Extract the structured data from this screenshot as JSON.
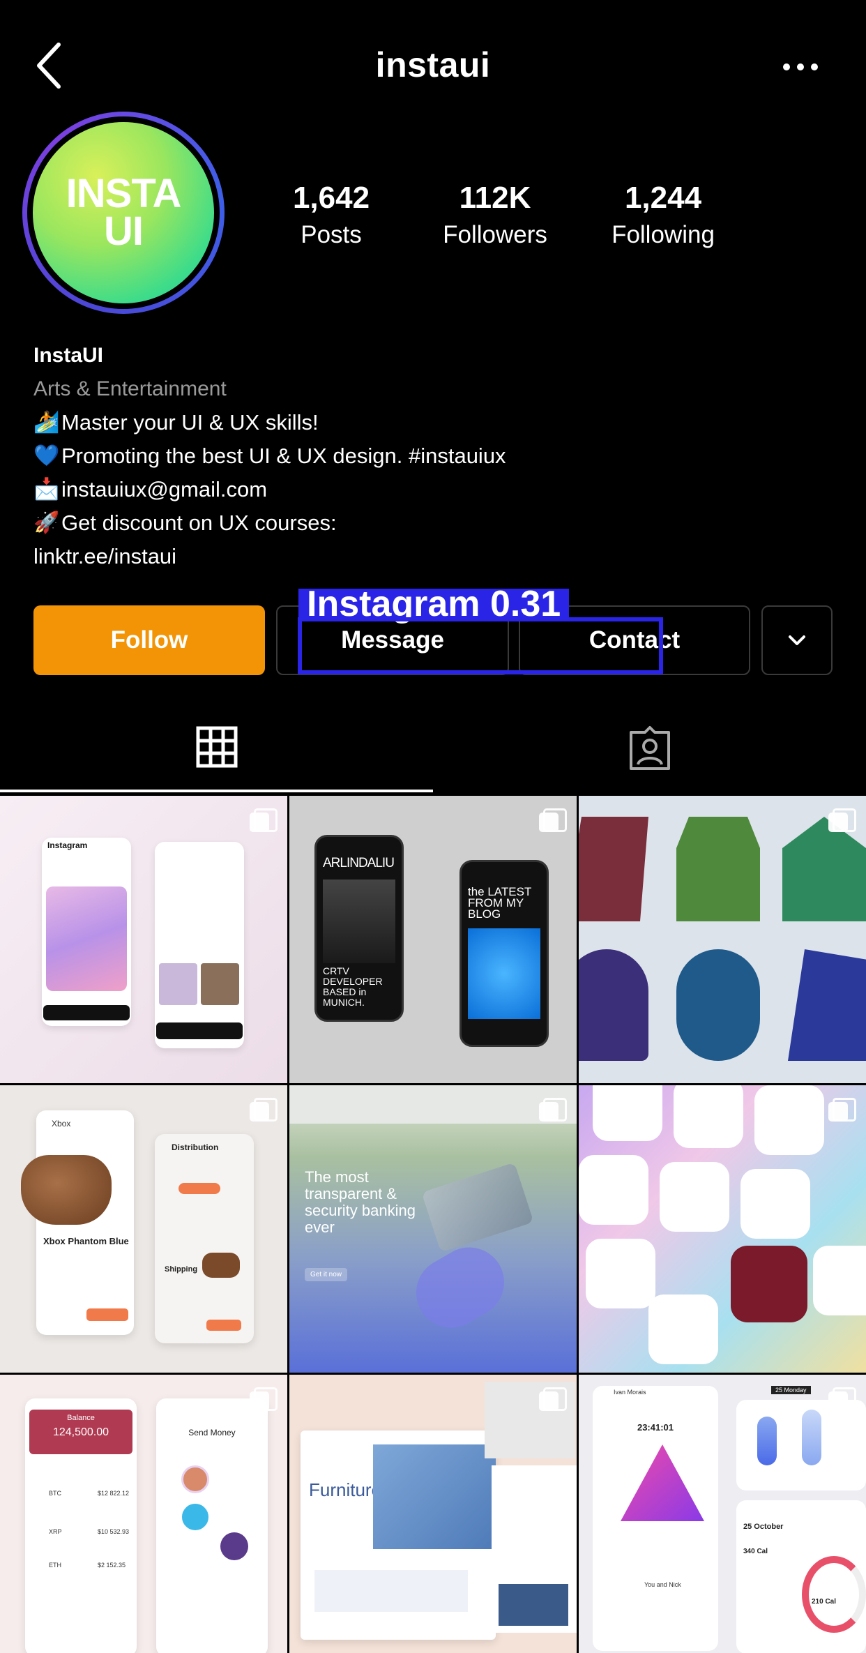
{
  "header": {
    "username": "instaui",
    "back_icon": "chevron-left-icon",
    "more_icon": "ellipsis-icon"
  },
  "profile": {
    "avatar_line1": "INSTA",
    "avatar_line2": "UI",
    "stats": [
      {
        "value": "1,642",
        "label": "Posts"
      },
      {
        "value": "112K",
        "label": "Followers"
      },
      {
        "value": "1,244",
        "label": "Following"
      }
    ],
    "name": "InstaUI",
    "category": "Arts & Entertainment",
    "bio_lines": [
      {
        "emoji": "🏄",
        "text": "Master your UI & UX skills!"
      },
      {
        "emoji": "💙",
        "text": "Promoting the best UI & UX design. #instauiux"
      },
      {
        "emoji": "📩",
        "text": " instauiux@gmail.com"
      },
      {
        "emoji": "🚀",
        "text": "Get discount on UX courses:"
      }
    ],
    "link": "linktr.ee/instaui"
  },
  "actions": {
    "follow": "Follow",
    "message": "Message",
    "contact": "Contact"
  },
  "overlay": {
    "label": "Instagram  0.31"
  },
  "tabs": [
    {
      "name": "grid",
      "icon": "grid-icon"
    },
    {
      "name": "tagged",
      "icon": "tagged-person-icon"
    }
  ],
  "posts": [
    {
      "title": "Instagram",
      "balance_amount": ""
    },
    {
      "left_text": "ARLINDALIU",
      "left_sub": "CRTV DEVELOPER BASED in MUNICH.",
      "right_text": "the LATEST FROM MY BLOG"
    },
    {
      "title": ""
    },
    {
      "title": "Xbox Phantom Blue",
      "right_title": "Distribution",
      "shipping": "Shipping",
      "back": "Xbox"
    },
    {
      "headline": "The most transparent & security banking ever",
      "cta": "Get it now"
    },
    {
      "title": ""
    },
    {
      "title": "Balance",
      "amount": "124,500.00",
      "send": "Send Money",
      "coins": [
        "BTC",
        "XRP",
        "ETH"
      ],
      "values": [
        "$12 822.12",
        "$10 532.93",
        "$2 152.35"
      ]
    },
    {
      "title": "Furniture."
    },
    {
      "time": "23:41:01",
      "name": "Ivan Morais",
      "date": "25 October",
      "cal1": "340 Cal",
      "cal2": "210 Cal",
      "chip": "25 Monday",
      "pair": "You and Nick"
    }
  ],
  "colors": {
    "follow": "#f29406",
    "overlay": "#2a25e6",
    "category": "#9a9a9a"
  }
}
